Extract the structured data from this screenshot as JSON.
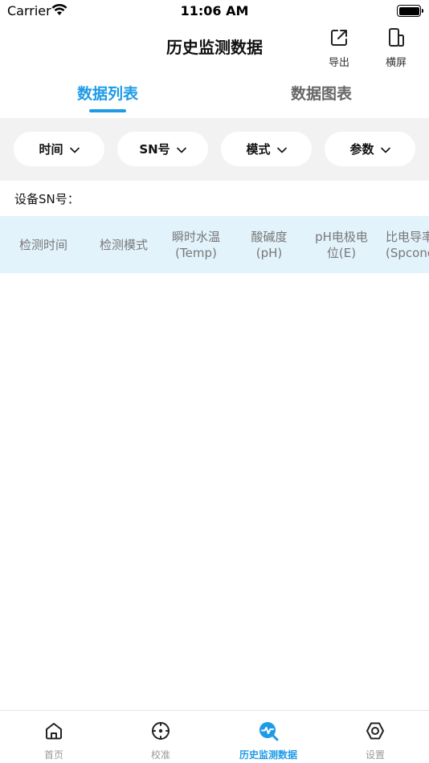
{
  "status_bar": {
    "carrier": "Carrier",
    "time": "11:06 AM"
  },
  "nav": {
    "title": "历史监测数据",
    "export_label": "导出",
    "landscape_label": "横屏"
  },
  "tabs": [
    {
      "label": "数据列表",
      "active": true
    },
    {
      "label": "数据图表",
      "active": false
    }
  ],
  "filters": [
    {
      "label": "时间"
    },
    {
      "label": "SN号"
    },
    {
      "label": "模式"
    },
    {
      "label": "参数"
    }
  ],
  "device_sn_label": "设备SN号：",
  "table": {
    "columns": [
      "检测时间",
      "检测模式",
      "瞬时水温\n(Temp)",
      "酸碱度\n(pH)",
      "pH电极电\n位(E)",
      "比电导率\n(Spcond)"
    ],
    "rows": []
  },
  "bottom_tabs": [
    {
      "label": "首页",
      "icon": "home-icon",
      "active": false
    },
    {
      "label": "校准",
      "icon": "calibrate-icon",
      "active": false
    },
    {
      "label": "历史监测数据",
      "icon": "history-monitor-icon",
      "active": true
    },
    {
      "label": "设置",
      "icon": "settings-icon",
      "active": false
    }
  ],
  "colors": {
    "accent": "#1e9be6",
    "header_bg": "#e3f3fb",
    "filter_bg": "#f2f2f2"
  }
}
